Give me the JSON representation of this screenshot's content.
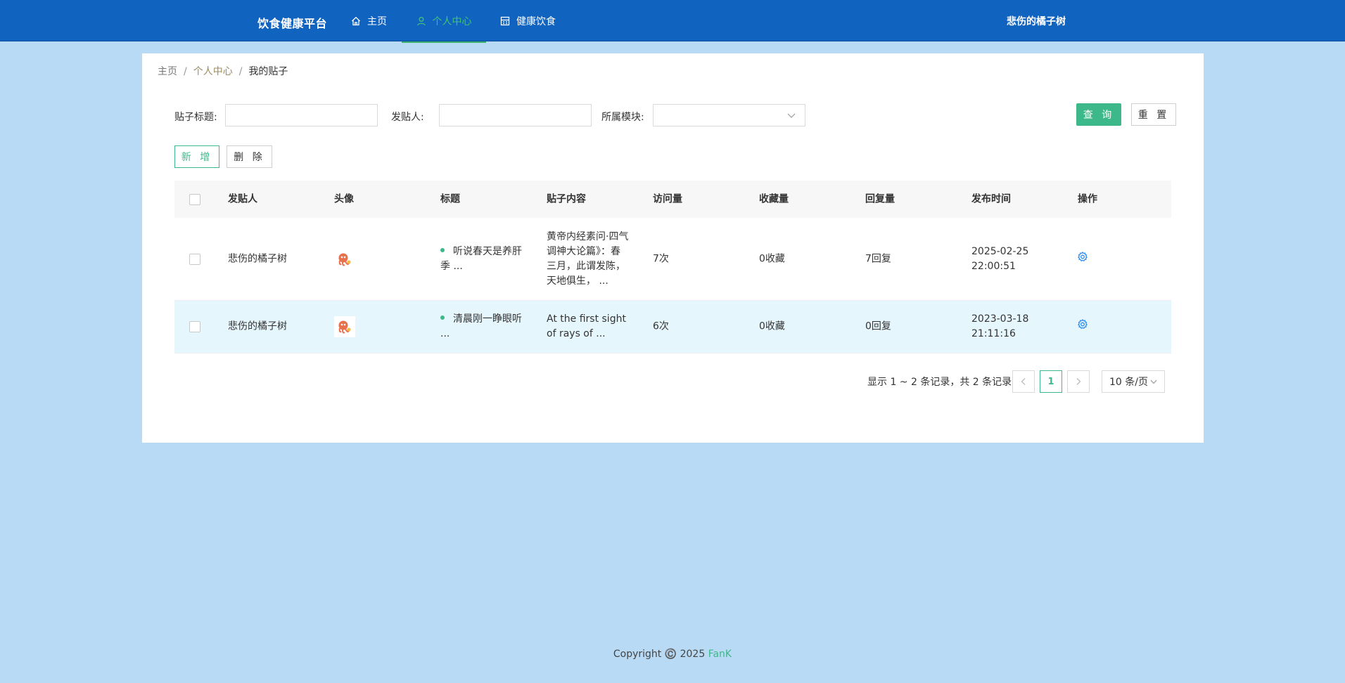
{
  "nav": {
    "brand": "饮食健康平台",
    "items": [
      {
        "label": "主页",
        "icon": "home-icon"
      },
      {
        "label": "个人中心",
        "icon": "user-icon"
      },
      {
        "label": "健康饮食",
        "icon": "calculator-icon"
      }
    ],
    "username": "悲伤的橘子树"
  },
  "breadcrumb": {
    "home": "主页",
    "center": "个人中心",
    "current": "我的贴子",
    "sep": "/"
  },
  "filters": {
    "title_label": "贴子标题:",
    "poster_label": "发贴人:",
    "module_label": "所属模块:",
    "title_value": "",
    "poster_value": "",
    "module_value": ""
  },
  "buttons": {
    "query": "查 询",
    "reset": "重 置",
    "add": "新 增",
    "delete": "删 除"
  },
  "table": {
    "headers": [
      "发贴人",
      "头像",
      "标题",
      "贴子内容",
      "访问量",
      "收藏量",
      "回复量",
      "发布时间",
      "操作"
    ],
    "rows": [
      {
        "poster": "悲伤的橘子树",
        "title": "听说春天是养肝季 ...",
        "content": "黄帝内经素问·四气调神大论篇》：春三月，此谓发陈，天地俱生，  ...",
        "visits": "7次",
        "favorites": "0收藏",
        "replies": "7回复",
        "time": "2025-02-25 22:00:51"
      },
      {
        "poster": "悲伤的橘子树",
        "title": "清晨刚一睁眼听 ...",
        "content": "At the first sight of rays of ...",
        "visits": "6次",
        "favorites": "0收藏",
        "replies": "0回复",
        "time": "2023-03-18 21:11:16"
      }
    ]
  },
  "pagination": {
    "info": "显示 1 ~ 2 条记录，共 2 条记录",
    "current": "1",
    "size": "10 条/页"
  },
  "footer": {
    "copyright": "Copyright ©️ 2025 ",
    "author": "FanK"
  },
  "colors": {
    "nav_bg": "#1163c0",
    "page_bg": "#b8daf4",
    "accent": "#3db88a",
    "active_nav": "#42c17a",
    "gear": "#2d8cf0"
  }
}
